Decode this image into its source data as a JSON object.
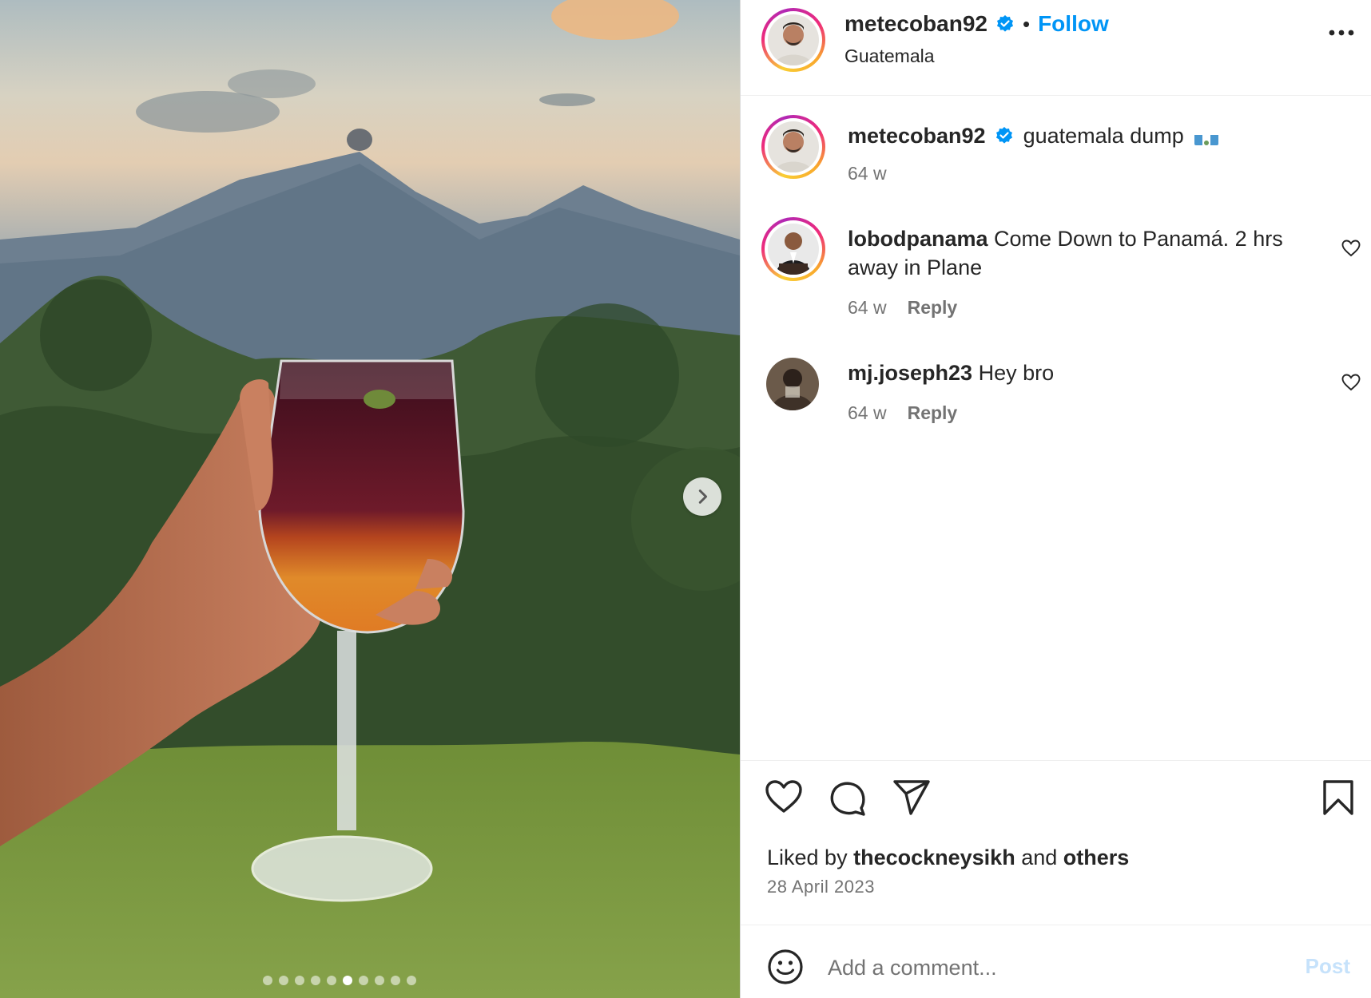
{
  "post": {
    "nav_next_icon": "chevron-right-icon",
    "carousel": {
      "count": 10,
      "active": 5
    }
  },
  "header": {
    "username": "metecoban92",
    "separator": "•",
    "follow_label": "Follow",
    "location": "Guatemala",
    "more_icon": "more-horizontal-icon"
  },
  "caption": {
    "username": "metecoban92",
    "text": "guatemala dump",
    "age": "64 w"
  },
  "comments": [
    {
      "username": "lobodpanama",
      "text": "Come Down to Panamá. 2 hrs away in Plane",
      "age": "64 w",
      "reply_label": "Reply"
    },
    {
      "username": "mj.joseph23",
      "text": "Hey bro",
      "age": "64 w",
      "reply_label": "Reply"
    }
  ],
  "actions": {
    "like_icon": "heart-icon",
    "comment_icon": "comment-icon",
    "share_icon": "send-icon",
    "save_icon": "bookmark-icon"
  },
  "likes": {
    "prefix": "Liked by",
    "user": "thecockneysikh",
    "middle": "and",
    "suffix": "others"
  },
  "date": "28 April 2023",
  "comment_box": {
    "placeholder": "Add a comment...",
    "post_label": "Post",
    "emoji_icon": "emoji-icon"
  },
  "colors": {
    "accent": "#0095f6",
    "post_disabled": "#c6e2fb",
    "secondary_text": "#737373"
  }
}
